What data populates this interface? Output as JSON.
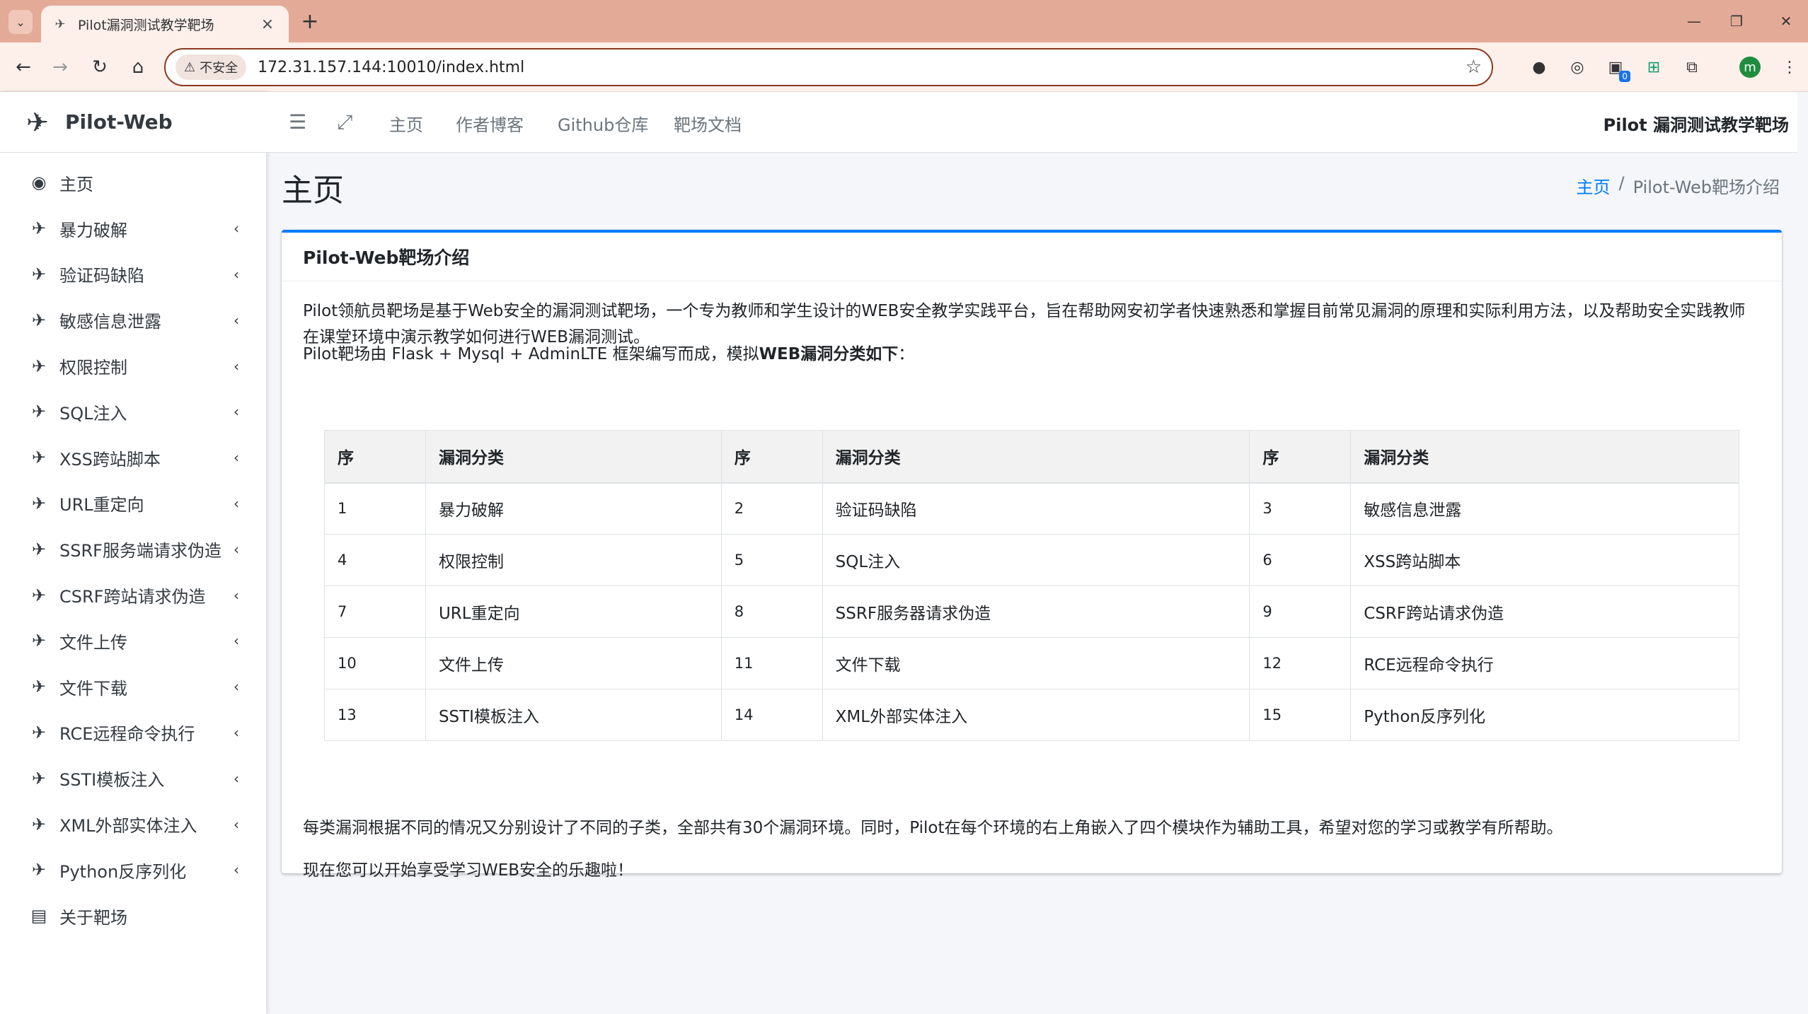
{
  "browser": {
    "tab_title": "Pilot漏洞测试教学靶场",
    "security_label": "不安全",
    "url": "172.31.157.144:10010/index.html",
    "extension_badge": "0",
    "profile_initial": "m"
  },
  "sidebar": {
    "brand": "Pilot-Web",
    "items": [
      {
        "label": "主页",
        "icon": "globe-icon",
        "has_arrow": false
      },
      {
        "label": "暴力破解",
        "icon": "plane-icon",
        "has_arrow": true
      },
      {
        "label": "验证码缺陷",
        "icon": "plane-icon",
        "has_arrow": true
      },
      {
        "label": "敏感信息泄露",
        "icon": "plane-icon",
        "has_arrow": true
      },
      {
        "label": "权限控制",
        "icon": "plane-icon",
        "has_arrow": true
      },
      {
        "label": "SQL注入",
        "icon": "plane-icon",
        "has_arrow": true
      },
      {
        "label": "XSS跨站脚本",
        "icon": "plane-icon",
        "has_arrow": true
      },
      {
        "label": "URL重定向",
        "icon": "plane-icon",
        "has_arrow": true
      },
      {
        "label": "SSRF服务端请求伪造",
        "icon": "plane-icon",
        "has_arrow": true
      },
      {
        "label": "CSRF跨站请求伪造",
        "icon": "plane-icon",
        "has_arrow": true
      },
      {
        "label": "文件上传",
        "icon": "plane-icon",
        "has_arrow": true
      },
      {
        "label": "文件下载",
        "icon": "plane-icon",
        "has_arrow": true
      },
      {
        "label": "RCE远程命令执行",
        "icon": "plane-icon",
        "has_arrow": true
      },
      {
        "label": "SSTI模板注入",
        "icon": "plane-icon",
        "has_arrow": true
      },
      {
        "label": "XML外部实体注入",
        "icon": "plane-icon",
        "has_arrow": true
      },
      {
        "label": "Python反序列化",
        "icon": "plane-icon",
        "has_arrow": true
      },
      {
        "label": "关于靶场",
        "icon": "book-icon",
        "has_arrow": false
      }
    ]
  },
  "topnav": {
    "links": [
      "主页",
      "作者博客",
      "Github仓库",
      "靶场文档"
    ],
    "title": "Pilot 漏洞测试教学靶场"
  },
  "header": {
    "page_title": "主页",
    "breadcrumb_home": "主页",
    "breadcrumb_sep": "/",
    "breadcrumb_current": "Pilot-Web靶场介绍"
  },
  "card": {
    "title": "Pilot-Web靶场介绍",
    "intro": "Pilot领航员靶场是基于Web安全的漏洞测试靶场，一个专为教师和学生设计的WEB安全教学实践平台，旨在帮助网安初学者快速熟悉和掌握目前常见漏洞的原理和实际利用方法，以及帮助安全实践教师在课堂环境中演示教学如何进行WEB漏洞测试。",
    "framework_prefix": "Pilot靶场由 Flask + Mysql + AdminLTE 框架编写而成，模拟",
    "framework_bold": "WEB漏洞分类如下",
    "framework_suffix": "：",
    "table_headers": [
      "序",
      "漏洞分类",
      "序",
      "漏洞分类",
      "序",
      "漏洞分类"
    ],
    "table_rows": [
      [
        "1",
        "暴力破解",
        "2",
        "验证码缺陷",
        "3",
        "敏感信息泄露"
      ],
      [
        "4",
        "权限控制",
        "5",
        "SQL注入",
        "6",
        "XSS跨站脚本"
      ],
      [
        "7",
        "URL重定向",
        "8",
        "SSRF服务器请求伪造",
        "9",
        "CSRF跨站请求伪造"
      ],
      [
        "10",
        "文件上传",
        "11",
        "文件下载",
        "12",
        "RCE远程命令执行"
      ],
      [
        "13",
        "SSTI模板注入",
        "14",
        "XML外部实体注入",
        "15",
        "Python反序列化"
      ]
    ],
    "summary": "每类漏洞根据不同的情况又分别设计了不同的子类，全部共有30个漏洞环境。同时，Pilot在每个环境的右上角嵌入了四个模块作为辅助工具，希望对您的学习或教学有所帮助。",
    "closing": "现在您可以开始享受学习WEB安全的乐趣啦！"
  },
  "colors": {
    "tabbar": "#e3aa97",
    "accent": "#007bff",
    "sidebar_text": "#343a40"
  }
}
